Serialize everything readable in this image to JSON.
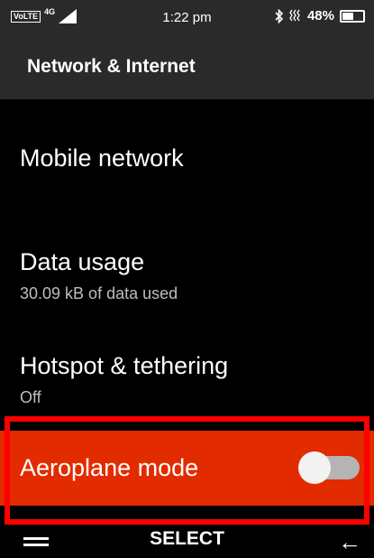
{
  "status_bar": {
    "volte": "VoLTE",
    "network_type": "4G",
    "time": "1:22 pm",
    "battery_percent": "48%",
    "battery_level": 0.48,
    "icons": [
      "signal-icon",
      "bluetooth-icon",
      "vibrate-icon",
      "battery-icon"
    ]
  },
  "header": {
    "title": "Network & Internet"
  },
  "settings": {
    "mobile_network": {
      "title": "Mobile network"
    },
    "data_usage": {
      "title": "Data usage",
      "subtitle": "30.09 kB of data used"
    },
    "hotspot": {
      "title": "Hotspot & tethering",
      "subtitle": "Off"
    },
    "aeroplane": {
      "title": "Aeroplane mode",
      "toggle_on": false
    }
  },
  "softkeys": {
    "left_icon": "menu-icon",
    "center": "SELECT",
    "right_icon": "back-arrow-icon"
  },
  "colors": {
    "highlight": "#e32b00",
    "frame": "#ff0000",
    "header_bg": "#2a2a2a",
    "background": "#000000"
  }
}
